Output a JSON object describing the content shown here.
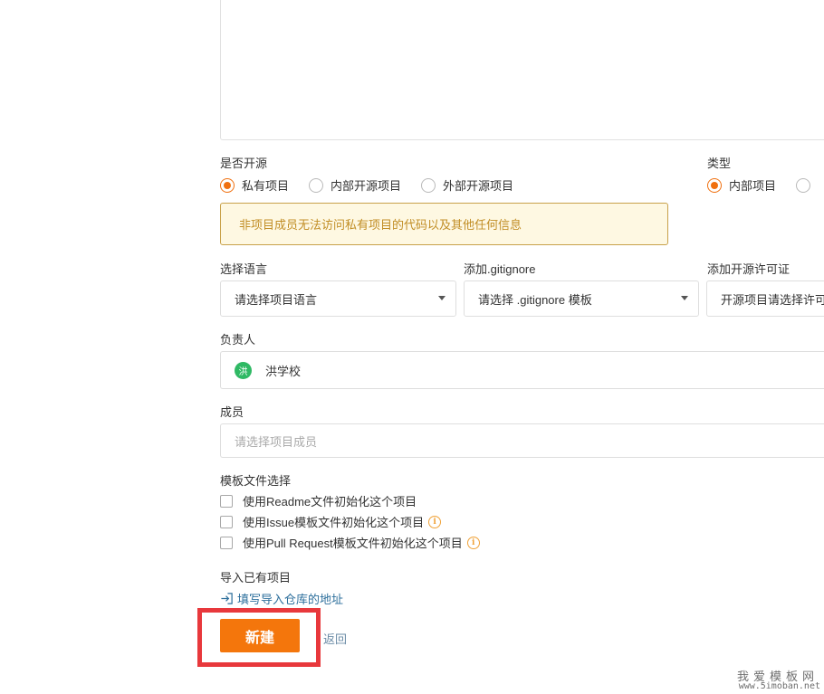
{
  "open_source": {
    "label": "是否开源",
    "options": [
      "私有项目",
      "内部开源项目",
      "外部开源项目"
    ],
    "selected": "私有项目",
    "warning": "非项目成员无法访问私有项目的代码以及其他任何信息"
  },
  "type": {
    "label": "类型",
    "options": [
      "内部项目"
    ],
    "selected": "内部项目"
  },
  "language": {
    "label": "选择语言",
    "value": "请选择项目语言"
  },
  "gitignore": {
    "label": "添加.gitignore",
    "value": "请选择 .gitignore 模板"
  },
  "license": {
    "label": "添加开源许可证",
    "value": "开源项目请选择许可"
  },
  "owner": {
    "label": "负责人",
    "avatar_text": "洪",
    "name": "洪学校"
  },
  "members": {
    "label": "成员",
    "placeholder": "请选择项目成员"
  },
  "templates": {
    "label": "模板文件选择",
    "items": [
      "使用Readme文件初始化这个项目",
      "使用Issue模板文件初始化这个项目",
      "使用Pull Request模板文件初始化这个项目"
    ]
  },
  "import": {
    "label": "导入已有项目",
    "link": "填写导入仓库的地址"
  },
  "actions": {
    "create": "新建",
    "back": "返回"
  },
  "watermark": {
    "line1": "我爱模板网",
    "line2": "www.5imoban.net"
  },
  "colors": {
    "accent": "#f4760c",
    "highlight": "#e8383c",
    "warning_text": "#c18d24"
  }
}
